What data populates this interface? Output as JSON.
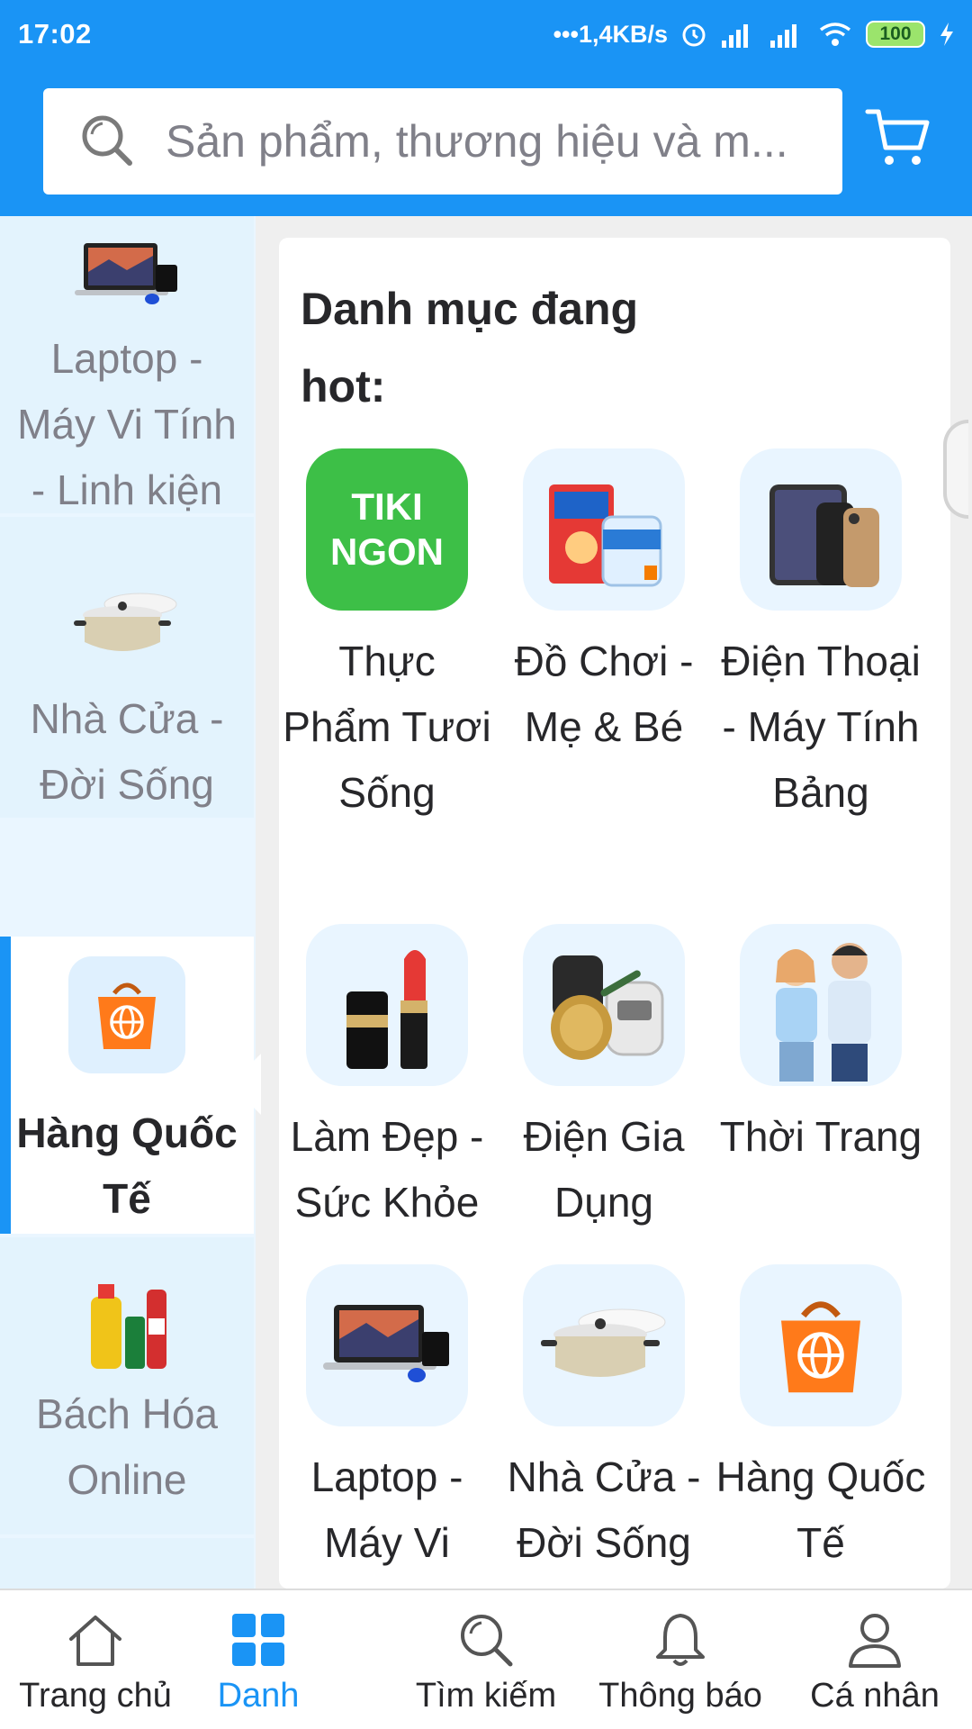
{
  "status_bar": {
    "time": "17:02",
    "network_speed": "•••1,4KB/s",
    "battery": "100"
  },
  "header": {
    "search_placeholder": "Sản phẩm, thương hiệu và m...",
    "search_icon": "search-icon",
    "cart_icon": "cart-icon"
  },
  "sidebar": {
    "items": [
      {
        "label": "Laptop - Máy Vi Tính - Linh kiện",
        "icon": "laptop-icon"
      },
      {
        "label": "Nhà Cửa - Đời Sống",
        "icon": "cookware-icon"
      },
      {
        "label": "Hàng Quốc Tế",
        "icon": "international-bag-icon",
        "active": true
      },
      {
        "label": "Bách Hóa Online",
        "icon": "grocery-icon"
      }
    ]
  },
  "main": {
    "section_title": "Danh mục đang hot:",
    "categories": [
      {
        "label": "Thực Phẩm Tươi Sống",
        "icon": "tiki-ngon-logo",
        "logo_text": "TIKI NGON"
      },
      {
        "label": "Đồ Chơi - Mẹ & Bé",
        "icon": "baby-products-icon"
      },
      {
        "label": "Điện Thoại - Máy Tính Bảng",
        "icon": "phones-icon"
      },
      {
        "label": "Làm Đẹp - Sức Khỏe",
        "icon": "beauty-icon"
      },
      {
        "label": "Điện Gia Dụng",
        "icon": "appliances-icon"
      },
      {
        "label": "Thời Trang",
        "icon": "fashion-icon"
      },
      {
        "label": "Laptop - Máy Vi",
        "icon": "laptop-icon"
      },
      {
        "label": "Nhà Cửa - Đời Sống",
        "icon": "cookware-icon"
      },
      {
        "label": "Hàng Quốc Tế",
        "icon": "international-bag-icon"
      }
    ]
  },
  "bottom_nav": {
    "items": [
      {
        "label": "Trang chủ",
        "icon": "home-icon"
      },
      {
        "label": "Danh",
        "icon": "categories-icon",
        "active": true
      },
      {
        "label": "Tìm kiếm",
        "icon": "search-icon"
      },
      {
        "label": "Thông báo",
        "icon": "bell-icon"
      },
      {
        "label": "Cá nhân",
        "icon": "user-icon"
      }
    ]
  },
  "colors": {
    "brand_blue": "#1a94f5",
    "sidebar_bg": "#e3f3fd",
    "muted_text": "#808089",
    "tiki_green": "#3dbf47",
    "bag_orange": "#ff7a1a"
  }
}
